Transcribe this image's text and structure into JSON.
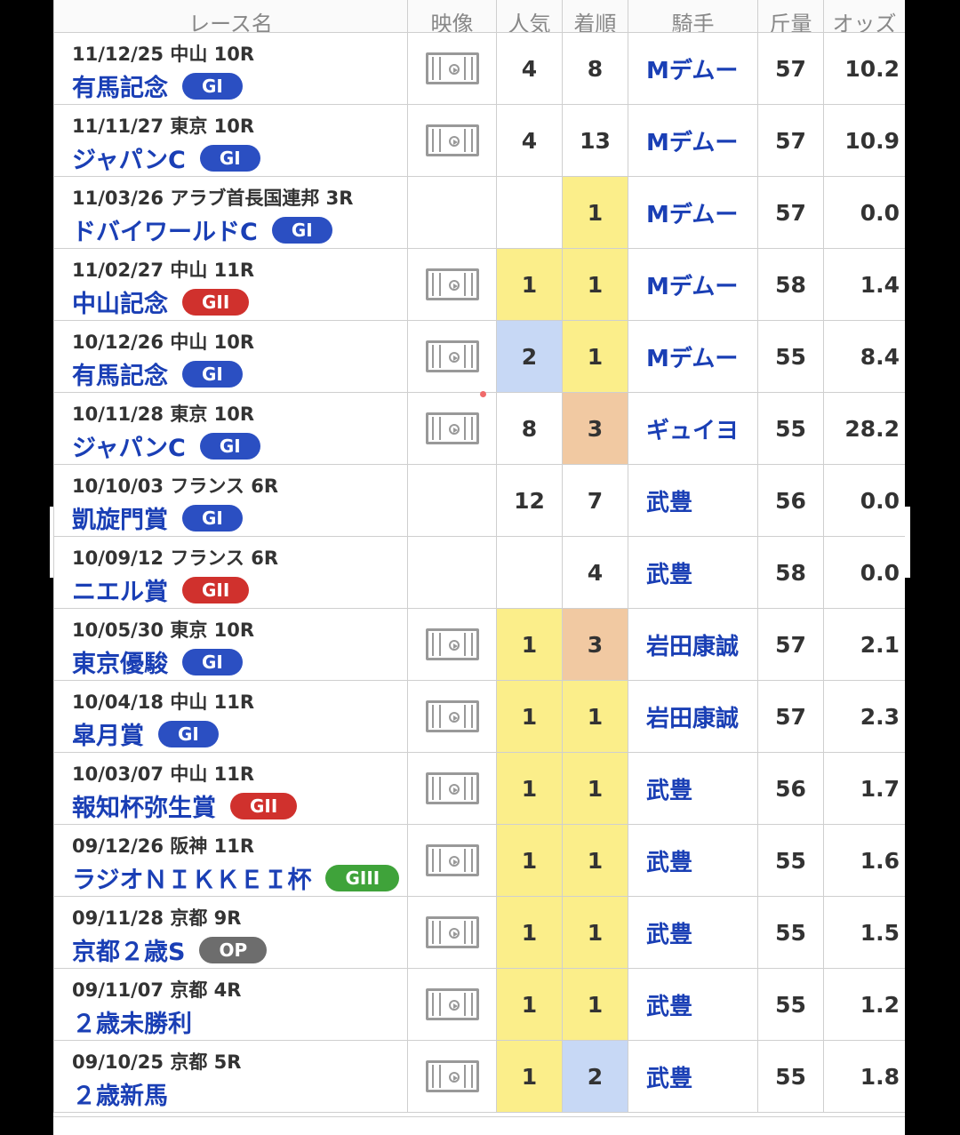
{
  "header": {
    "col_race": "レース名",
    "col_video": "映像",
    "col_pop": "人気",
    "col_rank": "着順",
    "col_jockey": "騎手",
    "col_weight": "斤量",
    "col_odds": "オッズ"
  },
  "rows": [
    {
      "date_place": "11/12/25 中山 10R",
      "race": "有馬記念",
      "grade": "GI",
      "video": true,
      "pop": "4",
      "rank": "8",
      "jockey": "Mデムー",
      "weight": "57",
      "odds": "10.2",
      "pop_hl": "",
      "rank_hl": ""
    },
    {
      "date_place": "11/11/27 東京 10R",
      "race": "ジャパンC",
      "grade": "GI",
      "video": true,
      "pop": "4",
      "rank": "13",
      "jockey": "Mデムー",
      "weight": "57",
      "odds": "10.9",
      "pop_hl": "",
      "rank_hl": ""
    },
    {
      "date_place": "11/03/26 アラブ首長国連邦 3R",
      "race": "ドバイワールドC",
      "grade": "GI",
      "video": false,
      "pop": "",
      "rank": "1",
      "jockey": "Mデムー",
      "weight": "57",
      "odds": "0.0",
      "pop_hl": "",
      "rank_hl": "yellow"
    },
    {
      "date_place": "11/02/27 中山 11R",
      "race": "中山記念",
      "grade": "GII",
      "video": true,
      "pop": "1",
      "rank": "1",
      "jockey": "Mデムー",
      "weight": "58",
      "odds": "1.4",
      "pop_hl": "yellow",
      "rank_hl": "yellow"
    },
    {
      "date_place": "10/12/26 中山 10R",
      "race": "有馬記念",
      "grade": "GI",
      "video": true,
      "pop": "2",
      "rank": "1",
      "jockey": "Mデムー",
      "weight": "55",
      "odds": "8.4",
      "pop_hl": "blue",
      "rank_hl": "yellow"
    },
    {
      "date_place": "10/11/28 東京 10R",
      "race": "ジャパンC",
      "grade": "GI",
      "video": true,
      "pop": "8",
      "rank": "3",
      "jockey": "ギュイヨ",
      "weight": "55",
      "odds": "28.2",
      "pop_hl": "",
      "rank_hl": "orange"
    },
    {
      "date_place": "10/10/03 フランス 6R",
      "race": "凱旋門賞",
      "grade": "GI",
      "video": false,
      "pop": "12",
      "rank": "7",
      "jockey": "武豊",
      "weight": "56",
      "odds": "0.0",
      "pop_hl": "",
      "rank_hl": ""
    },
    {
      "date_place": "10/09/12 フランス 6R",
      "race": "ニエル賞",
      "grade": "GII",
      "video": false,
      "pop": "",
      "rank": "4",
      "jockey": "武豊",
      "weight": "58",
      "odds": "0.0",
      "pop_hl": "",
      "rank_hl": ""
    },
    {
      "date_place": "10/05/30 東京 10R",
      "race": "東京優駿",
      "grade": "GI",
      "video": true,
      "pop": "1",
      "rank": "3",
      "jockey": "岩田康誠",
      "weight": "57",
      "odds": "2.1",
      "pop_hl": "yellow",
      "rank_hl": "orange"
    },
    {
      "date_place": "10/04/18 中山 11R",
      "race": "皐月賞",
      "grade": "GI",
      "video": true,
      "pop": "1",
      "rank": "1",
      "jockey": "岩田康誠",
      "weight": "57",
      "odds": "2.3",
      "pop_hl": "yellow",
      "rank_hl": "yellow"
    },
    {
      "date_place": "10/03/07 中山 11R",
      "race": "報知杯弥生賞",
      "grade": "GII",
      "video": true,
      "pop": "1",
      "rank": "1",
      "jockey": "武豊",
      "weight": "56",
      "odds": "1.7",
      "pop_hl": "yellow",
      "rank_hl": "yellow"
    },
    {
      "date_place": "09/12/26 阪神 11R",
      "race": "ラジオＮＩＫＫＥＩ杯",
      "grade": "GIII",
      "video": true,
      "pop": "1",
      "rank": "1",
      "jockey": "武豊",
      "weight": "55",
      "odds": "1.6",
      "pop_hl": "yellow",
      "rank_hl": "yellow"
    },
    {
      "date_place": "09/11/28 京都 9R",
      "race": "京都２歳S",
      "grade": "OP",
      "video": true,
      "pop": "1",
      "rank": "1",
      "jockey": "武豊",
      "weight": "55",
      "odds": "1.5",
      "pop_hl": "yellow",
      "rank_hl": "yellow"
    },
    {
      "date_place": "09/11/07 京都 4R",
      "race": "２歳未勝利",
      "grade": "",
      "video": true,
      "pop": "1",
      "rank": "1",
      "jockey": "武豊",
      "weight": "55",
      "odds": "1.2",
      "pop_hl": "yellow",
      "rank_hl": "yellow"
    },
    {
      "date_place": "09/10/25 京都 5R",
      "race": "２歳新馬",
      "grade": "",
      "video": true,
      "pop": "1",
      "rank": "2",
      "jockey": "武豊",
      "weight": "55",
      "odds": "1.8",
      "pop_hl": "yellow",
      "rank_hl": "blue"
    }
  ],
  "colors": {
    "link": "#1a3fb5",
    "g1": "#2b4fc2",
    "g2": "#d0312d",
    "g3": "#3fa33a",
    "op": "#6d6d6d",
    "win": "#fbee8a",
    "second": "#c7d8f5",
    "third": "#f1c9a2"
  }
}
